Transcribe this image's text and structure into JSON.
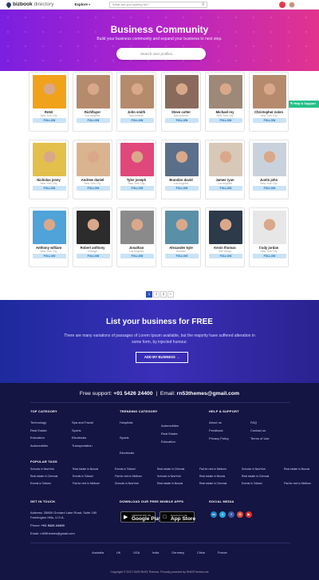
{
  "header": {
    "logo_text": "bizbook",
    "logo_sub": "directory",
    "explore_label": "Explore",
    "search_placeholder": "What are you looking for?",
    "search_icon": "search-icon"
  },
  "hero": {
    "title": "Business Community",
    "subtitle": "Build your business community and expand your business to next step.",
    "search_placeholder": "Search user profiles..."
  },
  "help_button": "Help & Support",
  "cards": [
    {
      "name": "Rn53",
      "city": "New York City",
      "color": "#f0a21a",
      "follow": "FOLLOW"
    },
    {
      "name": "Richflayer",
      "city": "Los Angeles",
      "color": "#b58a6d",
      "follow": "FOLLOW"
    },
    {
      "name": "John smith",
      "city": "San Antonio",
      "color": "#b58a6d",
      "follow": "FOLLOW"
    },
    {
      "name": "Steve cotter",
      "city": "San Antonio",
      "color": "#8a6a5c",
      "follow": "FOLLOW"
    },
    {
      "name": "Michael rey",
      "city": "New York City",
      "color": "#9e8878",
      "follow": "FOLLOW"
    },
    {
      "name": "Christopher nolen",
      "city": "New York City",
      "color": "#b58a6d",
      "follow": "FOLLOW"
    },
    {
      "name": "Nicholas joney",
      "city": "New York City",
      "color": "#e2c04b",
      "follow": "FOLLOW"
    },
    {
      "name": "Andrew daniel",
      "city": "New York City",
      "color": "#d9b48f",
      "follow": "FOLLOW"
    },
    {
      "name": "Tyler joseph",
      "city": "New York City",
      "color": "#e0477a",
      "follow": "FOLLOW"
    },
    {
      "name": "Brandon david",
      "city": "Los Angeles",
      "color": "#5a6f8a",
      "follow": "FOLLOW"
    },
    {
      "name": "James ryan",
      "city": "Los Angeles",
      "color": "#d8c8b8",
      "follow": "FOLLOW"
    },
    {
      "name": "Justin john",
      "city": "New York City",
      "color": "#c9d2dc",
      "follow": "FOLLOW"
    },
    {
      "name": "Anthony william",
      "city": "New York City",
      "color": "#4fa3d8",
      "follow": "FOLLOW"
    },
    {
      "name": "Robert anthony",
      "city": "Chicago",
      "color": "#2c2c2c",
      "follow": "FOLLOW"
    },
    {
      "name": "Jonathan",
      "city": "Los Angeles",
      "color": "#8a8a8a",
      "follow": "FOLLOW"
    },
    {
      "name": "Alexander kyle",
      "city": "Houston",
      "color": "#5a8fa8",
      "follow": "FOLLOW"
    },
    {
      "name": "Kevin thomas",
      "city": "San Diego",
      "color": "#2c3a4a",
      "follow": "FOLLOW"
    },
    {
      "name": "Cody jordan",
      "city": "New York City",
      "color": "#e7e7e7",
      "follow": "FOLLOW"
    }
  ],
  "pagination": [
    "1",
    "2",
    "3",
    "»"
  ],
  "cta": {
    "title": "List your business for FREE",
    "text": "There are many variations of passages of Lorem Ipsum available, but the majority have suffered alteration in some form, by injected humour.",
    "button": "ADD MY BUSINESS →"
  },
  "footer": {
    "support_label": "Free support:",
    "phone": "+01 5426 24400",
    "separator": "|",
    "email_label": "Email:",
    "email": "rn53themes@gmail.com",
    "top_category": {
      "title": "TOP CATEGORY",
      "col1": [
        "Technology",
        "Real Estate",
        "Education",
        "Automobiles"
      ],
      "col2": [
        "Spa and Facial",
        "Sports",
        "Electricals",
        "Transportation"
      ]
    },
    "trending_category": {
      "title": "TRENDING CATEGORY",
      "col1": [
        "Hospitals",
        "Sports",
        "Electricals"
      ],
      "col2": [
        "Automobiles",
        "Real Estate",
        "Education"
      ]
    },
    "help_support": {
      "title": "HELP & SUPPORT",
      "col1": [
        "About us",
        "Feedback",
        "Privacy Policy"
      ],
      "col2": [
        "FAQ",
        "Contact us",
        "Terms of Use"
      ]
    },
    "popular_tags": {
      "title": "POPULAR TAGS",
      "rows": [
        [
          "Schools in NewYork",
          "Real estate in Illunois",
          "Events in Tolland",
          "Real estate in Chennai",
          "Flat for rent in Melborn",
          "Schools in NewYork",
          "Real estate in Illunois"
        ],
        [
          "Real estate in Chennai",
          "Events in Tolland",
          "Flat for rent in Melborn",
          "Schools in NewYork",
          "Real estate in Illunois",
          "Real estate in Chennai"
        ],
        [
          "Events in Tolland",
          "Flat for rent in Melborn",
          "Schools in NewYork",
          "Real estate in Illunois",
          "Real estate in Chennai",
          "Events in Tolland",
          "Flat for rent in Melborn"
        ]
      ]
    },
    "get_in_touch": {
      "title": "GET IN TOUCH",
      "address": "Address: 28800 Orchard Lake Road, Suite 180 Farmington Hills, U.S.A.",
      "phone_label": "Phone:",
      "phone": "+01 5426 24400",
      "email_label": "Email:",
      "email": "rn53themes@gmail.com"
    },
    "apps": {
      "title": "DOWNLOAD OUR FREE MOBILE APPS",
      "google_small": "ANDROID APP ON",
      "google_big": "Google Play",
      "apple_small": "Download on the",
      "apple_big": "App Store"
    },
    "social": {
      "title": "SOCIAL MEDIA",
      "items": [
        {
          "icon": "linkedin-icon",
          "label": "in",
          "color": "#1e88c7"
        },
        {
          "icon": "twitter-icon",
          "label": "t",
          "color": "#28a9e0"
        },
        {
          "icon": "facebook-icon",
          "label": "f",
          "color": "#3b5ba8"
        },
        {
          "icon": "google-plus-icon",
          "label": "G",
          "color": "#dd4b39"
        },
        {
          "icon": "youtube-icon",
          "label": "▶",
          "color": "#e52d27"
        }
      ]
    },
    "countries": [
      "Australia",
      "UK",
      "USA",
      "India",
      "Germany",
      "China",
      "France"
    ],
    "copyright": "Copyright © 2017-2020 Rn53 Themes. Proudly powered by Rn53Themes.net"
  }
}
